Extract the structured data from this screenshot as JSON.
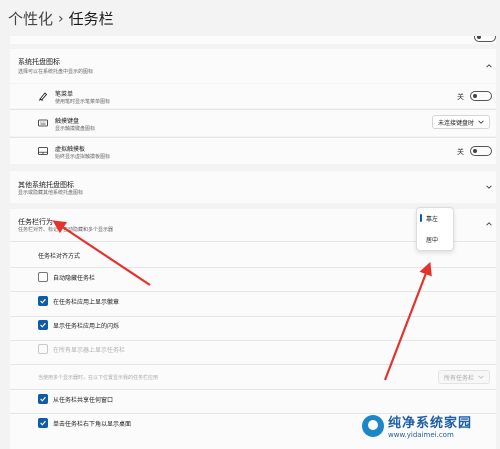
{
  "header": {
    "parent": "个性化",
    "separator": "›",
    "current": "任务栏"
  },
  "tray_icons_section": {
    "title": "系统托盘图标",
    "subtitle": "选择可以在系统托盘中显示的图标",
    "items": [
      {
        "icon": "pen-menu-icon",
        "title": "笔菜单",
        "subtitle": "使用笔时显示笔菜单图标",
        "toggle_label": "关",
        "toggle_on": false
      },
      {
        "icon": "touch-keyboard-icon",
        "title": "触摸键盘",
        "subtitle": "显示触摸键盘图标",
        "dropdown_value": "未连接键盘时"
      },
      {
        "icon": "virtual-touchpad-icon",
        "title": "虚拟触摸板",
        "subtitle": "始终显示虚拟触摸板图标",
        "toggle_label": "关",
        "toggle_on": false
      }
    ]
  },
  "other_tray_section": {
    "title": "其他系统托盘图标",
    "subtitle": "显示或隐藏其他系统托盘图标"
  },
  "behavior_section": {
    "title": "任务栏行为",
    "subtitle": "任务栏对齐、标记、自动隐藏和多个显示器",
    "alignment_label": "任务栏对齐方式",
    "alignment_options": [
      "靠左",
      "居中"
    ],
    "alignment_selected": "靠左",
    "checkboxes": [
      {
        "label": "自动隐藏任务栏",
        "checked": false,
        "disabled": false
      },
      {
        "label": "在任务栏应用上显示徽章",
        "checked": true,
        "disabled": false
      },
      {
        "label": "显示任务栏应用上的闪烁",
        "checked": true,
        "disabled": false
      },
      {
        "label": "在所有显示器上显示任务栏",
        "checked": false,
        "disabled": true
      }
    ],
    "multi_display_label": "当使用多个显示器时，在以下位置显示我的任务栏应用",
    "multi_display_value": "所有任务栏",
    "checkboxes_bottom": [
      {
        "label": "从任务栏共享任何窗口",
        "checked": true,
        "disabled": false
      },
      {
        "label": "单击任务栏右下角以显示桌面",
        "checked": true,
        "disabled": false
      }
    ]
  },
  "watermark": {
    "brand": "纯净系统家园",
    "url": "www.yidaimei.com"
  },
  "colors": {
    "accent": "#0d5ca9",
    "arrow": "#e5322d"
  }
}
